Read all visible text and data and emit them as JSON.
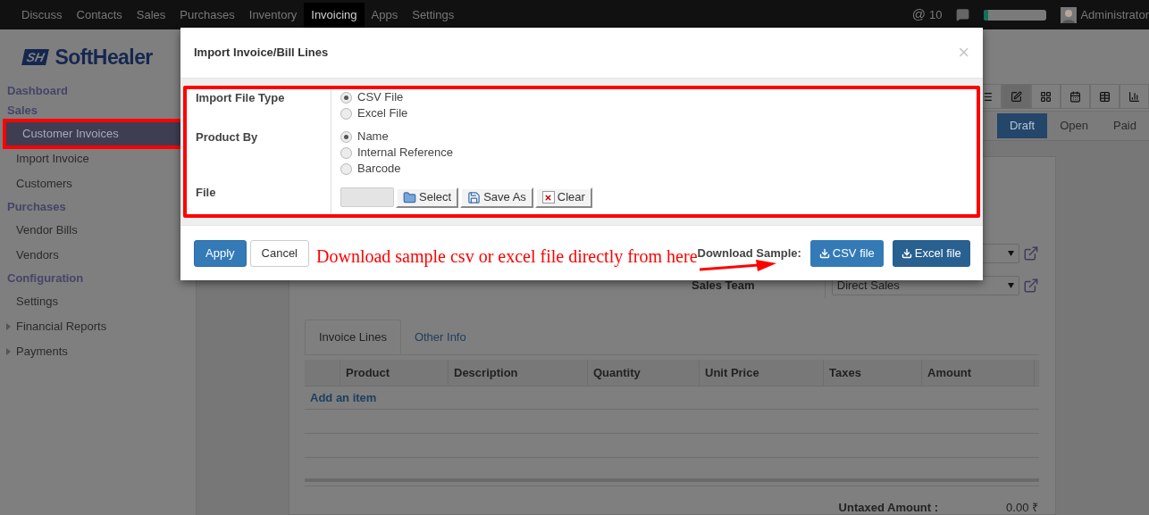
{
  "navbar": {
    "menu": [
      {
        "label": "Discuss",
        "selected": false
      },
      {
        "label": "Contacts",
        "selected": false
      },
      {
        "label": "Sales",
        "selected": false
      },
      {
        "label": "Purchases",
        "selected": false
      },
      {
        "label": "Inventory",
        "selected": false
      },
      {
        "label": "Invoicing",
        "selected": true
      },
      {
        "label": "Apps",
        "selected": false
      },
      {
        "label": "Settings",
        "selected": false
      }
    ],
    "mentions": "@",
    "mention_count": "10",
    "progress": {
      "level": 0.06
    },
    "user": "Administrator"
  },
  "sidebar": {
    "logo": {
      "mark": "SH",
      "name": "SoftHealer"
    },
    "sections": [
      {
        "title": "Dashboard"
      },
      {
        "title": "Sales",
        "items": [
          {
            "label": "Customer Invoices",
            "kind": "link",
            "selected": true,
            "highlighted": true
          },
          {
            "label": "Import Invoice",
            "kind": "link",
            "selected": false,
            "highlighted": false
          },
          {
            "label": "Customers",
            "kind": "link",
            "selected": false,
            "highlighted": false
          }
        ]
      },
      {
        "title": "Purchases",
        "items": [
          {
            "label": "Vendor Bills",
            "kind": "link",
            "selected": false,
            "highlighted": false
          },
          {
            "label": "Vendors",
            "kind": "link",
            "selected": false,
            "highlighted": false
          }
        ]
      },
      {
        "title": "Configuration",
        "items": [
          {
            "label": "Settings",
            "kind": "link",
            "selected": false,
            "highlighted": false
          },
          {
            "label": "Financial Reports",
            "kind": "submenu",
            "expanded": false,
            "selected": false,
            "highlighted": false
          },
          {
            "label": "Payments",
            "kind": "submenu",
            "expanded": false,
            "selected": false,
            "highlighted": false
          }
        ]
      }
    ]
  },
  "view_switcher": [
    {
      "kind": "list",
      "selected": false
    },
    {
      "kind": "form",
      "selected": true
    },
    {
      "kind": "kanban",
      "selected": false
    },
    {
      "kind": "calendar",
      "selected": false
    },
    {
      "kind": "pivot",
      "selected": false
    },
    {
      "kind": "graph",
      "selected": false
    }
  ],
  "statusbar": [
    {
      "label": "Draft",
      "selected": true
    },
    {
      "label": "Open",
      "selected": false
    },
    {
      "label": "Paid",
      "selected": false
    }
  ],
  "form": {
    "fields": [
      {
        "kind": "select"
      },
      {
        "kind": "select",
        "label": "Sales Team",
        "value": "Direct Sales"
      }
    ],
    "tabs": [
      {
        "label": "Invoice Lines",
        "selected": true
      },
      {
        "label": "Other Info",
        "selected": false
      }
    ],
    "table": {
      "columns": [
        "Product",
        "Description",
        "Quantity",
        "Unit Price",
        "Taxes",
        "Amount"
      ],
      "add_link": "Add an item"
    },
    "totals": [
      {
        "label": "Untaxed Amount :",
        "value": "0.00 ₹"
      }
    ]
  },
  "modal": {
    "title": "Import Invoice/Bill Lines",
    "close": "×",
    "highlighted": true,
    "fields": [
      {
        "label": "Import File Type",
        "kind": "radio",
        "options": [
          {
            "label": "CSV File",
            "selected": true
          },
          {
            "label": "Excel File",
            "selected": false
          }
        ]
      },
      {
        "label": "Product By",
        "kind": "radio",
        "options": [
          {
            "label": "Name",
            "selected": true
          },
          {
            "label": "Internal Reference",
            "selected": false
          },
          {
            "label": "Barcode",
            "selected": false
          }
        ]
      },
      {
        "label": "File",
        "kind": "file",
        "buttons": [
          {
            "label": "Select",
            "kind": "select"
          },
          {
            "label": "Save As",
            "kind": "save"
          },
          {
            "label": "Clear",
            "kind": "clear"
          }
        ]
      }
    ],
    "buttons": [
      {
        "label": "Apply",
        "kind": "primary"
      },
      {
        "label": "Cancel",
        "kind": "default"
      }
    ],
    "note": "Download sample csv or excel file directly from here",
    "download": {
      "label": "Download Sample:",
      "buttons": [
        {
          "label": "CSV file",
          "kind": "csv"
        },
        {
          "label": "Excel file",
          "kind": "excel"
        }
      ]
    }
  }
}
